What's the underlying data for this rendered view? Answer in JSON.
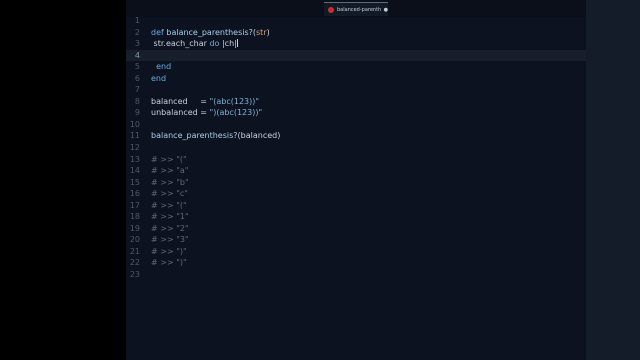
{
  "tab": {
    "title": "balanced-parenthesis...",
    "close_glyph": "●"
  },
  "lines": [
    {
      "num": "1",
      "parts": []
    },
    {
      "num": "2",
      "parts": [
        {
          "cls": "kw",
          "text": "def "
        },
        {
          "cls": "fn",
          "text": "balance_parenthesis?"
        },
        {
          "cls": "",
          "text": "("
        },
        {
          "cls": "param",
          "text": "str"
        },
        {
          "cls": "",
          "text": ")"
        }
      ]
    },
    {
      "num": "3",
      "parts": [
        {
          "cls": "",
          "text": " str.each_char "
        },
        {
          "cls": "kw",
          "text": "do"
        },
        {
          "cls": "",
          "text": " |ch|"
        }
      ]
    },
    {
      "num": "4",
      "parts": [],
      "active": true
    },
    {
      "num": "5",
      "parts": [
        {
          "cls": "kw",
          "text": "  end"
        }
      ]
    },
    {
      "num": "6",
      "parts": [
        {
          "cls": "kw",
          "text": "end"
        }
      ]
    },
    {
      "num": "7",
      "parts": []
    },
    {
      "num": "8",
      "parts": [
        {
          "cls": "",
          "text": "balanced     = "
        },
        {
          "cls": "str",
          "text": "\"(abc(123))\""
        }
      ]
    },
    {
      "num": "9",
      "parts": [
        {
          "cls": "",
          "text": "unbalanced = "
        },
        {
          "cls": "str",
          "text": "\")(abc(123))\""
        }
      ]
    },
    {
      "num": "10",
      "parts": []
    },
    {
      "num": "11",
      "parts": [
        {
          "cls": "fn",
          "text": "balance_parenthesis?"
        },
        {
          "cls": "",
          "text": "(balanced)"
        }
      ]
    },
    {
      "num": "12",
      "parts": []
    },
    {
      "num": "13",
      "parts": [
        {
          "cls": "cm",
          "text": "# >> \"(\""
        }
      ]
    },
    {
      "num": "14",
      "parts": [
        {
          "cls": "cm",
          "text": "# >> \"a\""
        }
      ]
    },
    {
      "num": "15",
      "parts": [
        {
          "cls": "cm",
          "text": "# >> \"b\""
        }
      ]
    },
    {
      "num": "16",
      "parts": [
        {
          "cls": "cm",
          "text": "# >> \"c\""
        }
      ]
    },
    {
      "num": "17",
      "parts": [
        {
          "cls": "cm",
          "text": "# >> \"(\""
        }
      ]
    },
    {
      "num": "18",
      "parts": [
        {
          "cls": "cm",
          "text": "# >> \"1\""
        }
      ]
    },
    {
      "num": "19",
      "parts": [
        {
          "cls": "cm",
          "text": "# >> \"2\""
        }
      ]
    },
    {
      "num": "20",
      "parts": [
        {
          "cls": "cm",
          "text": "# >> \"3\""
        }
      ]
    },
    {
      "num": "21",
      "parts": [
        {
          "cls": "cm",
          "text": "# >> \")\""
        }
      ]
    },
    {
      "num": "22",
      "parts": [
        {
          "cls": "cm",
          "text": "# >> \")\""
        }
      ]
    },
    {
      "num": "23",
      "parts": []
    }
  ]
}
